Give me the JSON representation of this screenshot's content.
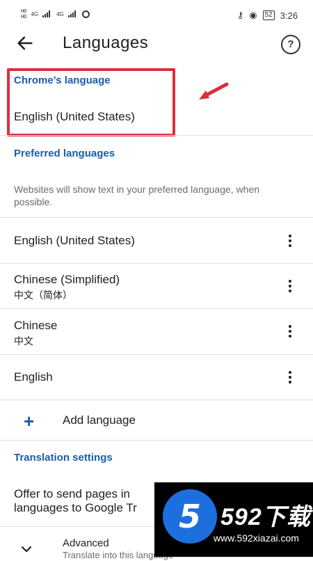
{
  "status_bar": {
    "sim1": "HD",
    "sim2": "HD",
    "net1": "4G",
    "net2": "4G",
    "battery": "52",
    "time": "3:26"
  },
  "app_bar": {
    "title": "Languages",
    "back_icon": "arrow-left-icon",
    "help_icon": "help-circle-icon",
    "help_glyph": "?"
  },
  "chrome_language": {
    "heading": "Chrome’s language",
    "value": "English (United States)"
  },
  "preferred": {
    "heading": "Preferred languages",
    "description": "Websites will show text in your preferred language, when possible.",
    "items": [
      {
        "name": "English (United States)",
        "native": ""
      },
      {
        "name": "Chinese (Simplified)",
        "native": "中文（简体）"
      },
      {
        "name": "Chinese",
        "native": "中文"
      },
      {
        "name": "English",
        "native": ""
      }
    ],
    "add_label": "Add language",
    "add_glyph": "+"
  },
  "translation": {
    "heading": "Translation settings",
    "offer_text_line1": "Offer to send pages in",
    "offer_text_line2": "languages to Google Tr",
    "advanced_label": "Advanced",
    "advanced_sub": "Translate into this language"
  },
  "annotation": {
    "highlight_color": "#d9303d"
  },
  "watermark": {
    "logo_text": "5",
    "brand": "592下载",
    "url": "www.592xiazai.com"
  },
  "colors": {
    "accent": "#1a5db0",
    "text": "#202124",
    "secondary": "#6b6b6b"
  }
}
